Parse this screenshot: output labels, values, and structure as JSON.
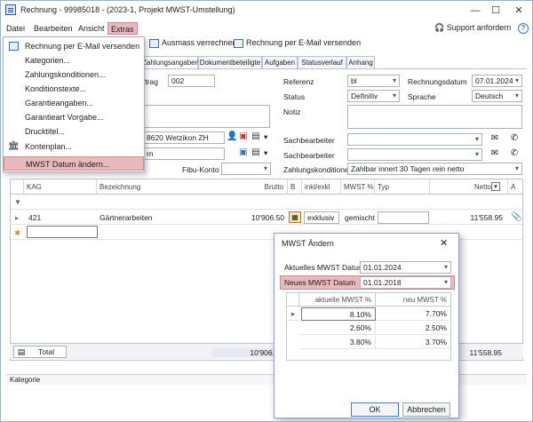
{
  "window": {
    "title": "Rechnung - 99985018 - (2023-1, Projekt MWST-Umstellung)"
  },
  "menu": {
    "items": [
      "Datei",
      "Bearbeiten",
      "Ansicht",
      "Extras"
    ],
    "support": "Support anfordern"
  },
  "toolbar": {
    "ausmass": "Ausmass verrechnen",
    "email": "Rechnung per E-Mail versenden"
  },
  "tabs": [
    "Zahlungsangaben",
    "Dokumentbeteiligte",
    "Aufgaben",
    "Statusverlauf",
    "Anhang"
  ],
  "form": {
    "auftrag_label": "ftrag",
    "auftrag_value": "002",
    "address_value": "8620 Wetzikon ZH",
    "second_value": "rn",
    "fibu_label": "Fibu-Konto",
    "referenz_label": "Referenz",
    "referenz_value": "bl",
    "status_label": "Status",
    "status_value": "Definitiv",
    "notiz_label": "Notiz",
    "rechnungsdatum_label": "Rechnungsdatum",
    "rechnungsdatum_value": "07.01.2024",
    "sprache_label": "Sprache",
    "sprache_value": "Deutsch",
    "sachbearbeiter_label": "Sachbearbeiter",
    "zahlungskonditionen_label": "Zahlungskonditionen",
    "zahlungskonditionen_value": "Zahlbar innert 30 Tagen rein netto"
  },
  "grid": {
    "headers": {
      "kag": "KAG",
      "bez": "Bezeichnung",
      "brutto": "Brutto",
      "b": "B",
      "inkl": "inkl/exkl",
      "mwst": "MWST %",
      "typ": "Typ",
      "netto": "Netto",
      "a": "A"
    },
    "row": {
      "kag": "421",
      "bez": "Gärtnerarbeiten",
      "brutto": "10'906.50",
      "inkl": "exklusiv",
      "mwst": "gemischt",
      "netto": "11'558.95"
    },
    "footer": {
      "total": "Total",
      "brutto": "10'906.",
      "netto": "11'558.95"
    }
  },
  "status": {
    "label": "Kategorie"
  },
  "extras_menu": {
    "items": [
      "Rechnung per E-Mail versenden",
      "Kategorien...",
      "Zahlungskonditionen...",
      "Konditionstexte...",
      "Garantieangaben...",
      "Garantieart Vorgabe...",
      "Drucktitel...",
      "Kontenplan...",
      "MWST Datum ändern..."
    ]
  },
  "dialog": {
    "title": "MWST Ändern",
    "aktuelles_label": "Aktuelles MWST Datum",
    "aktuelles_value": "01.01.2024",
    "neues_label": "Neues MWST Datum",
    "neues_value": "01.01.2018",
    "col_aktuell": "aktuelle MWST %",
    "col_neu": "neu MWST %",
    "rows": [
      {
        "aktuell": "8.10%",
        "neu": "7.70%"
      },
      {
        "aktuell": "2.60%",
        "neu": "2.50%"
      },
      {
        "aktuell": "3.80%",
        "neu": "3.70%"
      }
    ],
    "ok": "OK",
    "abbrechen": "Abbrechen"
  },
  "colors": {
    "highlight": "#e8b9bd",
    "accent": "#3a75c4"
  }
}
